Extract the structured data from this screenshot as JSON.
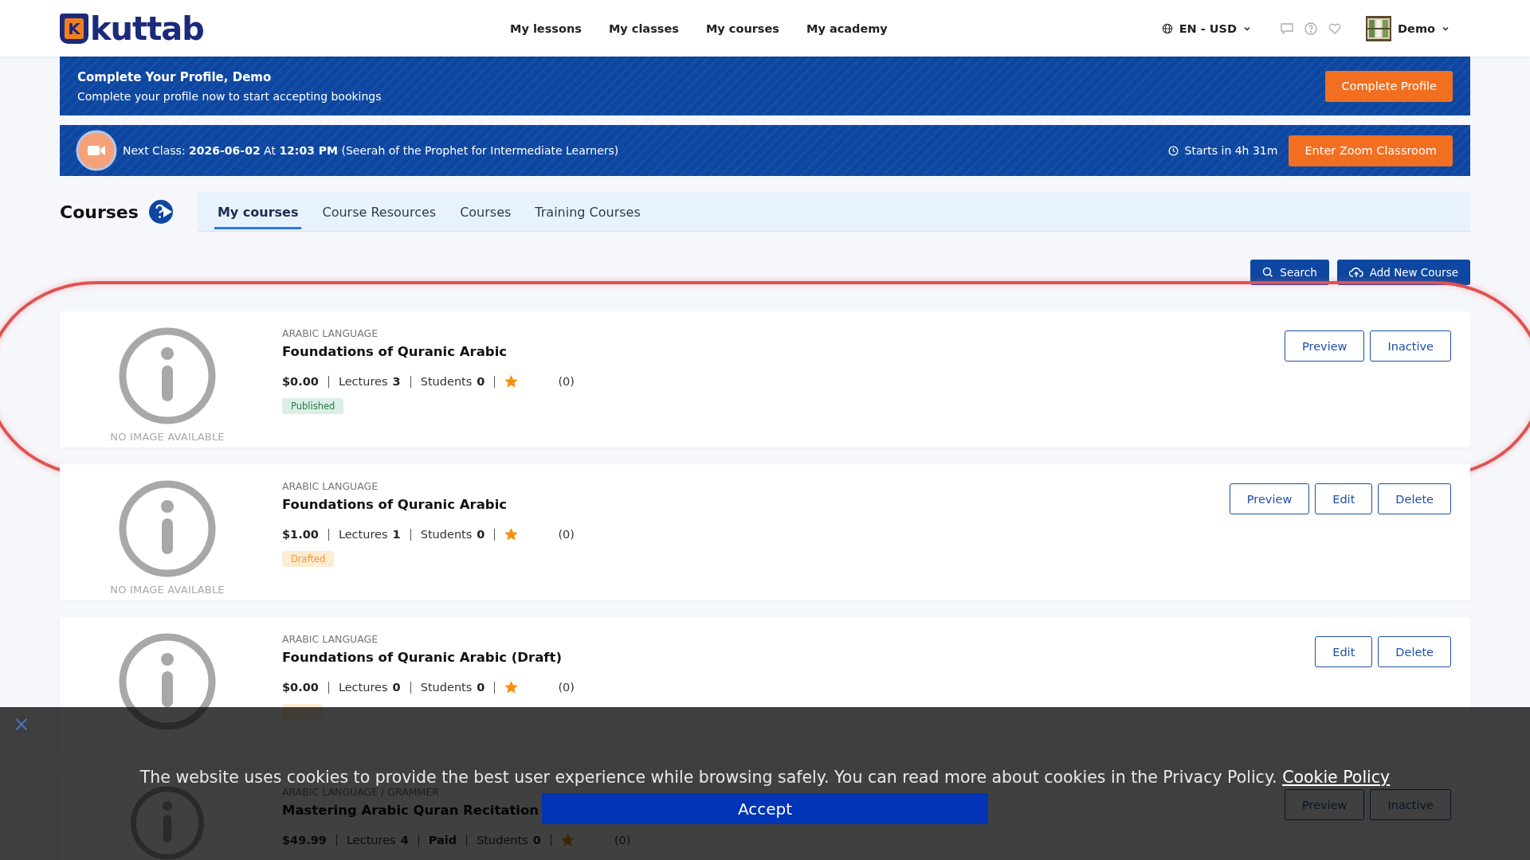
{
  "header": {
    "logo_mark": "K",
    "logo": "kuttab",
    "nav": [
      "My lessons",
      "My classes",
      "My courses",
      "My academy"
    ],
    "language": "EN - USD",
    "user": "Demo"
  },
  "profile_banner": {
    "title": "Complete Your Profile, Demo",
    "text": "Complete your profile now to start accepting bookings",
    "button": "Complete Profile"
  },
  "class_banner": {
    "text": "Next Class: **2026-06-02** At **12:03 PM** (Seerah of the Prophet for Intermediate Learners)",
    "countdown": "Starts in 4h 31m",
    "button": "Enter Zoom Classroom"
  },
  "page_title": "Courses",
  "tabs": [
    {
      "label": "My courses",
      "selected": true
    },
    {
      "label": "Course Resources",
      "selected": false
    },
    {
      "label": "Courses",
      "selected": false
    },
    {
      "label": "Training Courses",
      "selected": false
    }
  ],
  "actions": [
    {
      "label": "Search",
      "kind": "search"
    },
    {
      "label": "Add New Course",
      "kind": "upload"
    }
  ],
  "courses": [
    {
      "image_label": "NO IMAGE AVAILABLE",
      "category": "ARABIC LANGUAGE",
      "title": "Foundations of Quranic Arabic",
      "stats": [
        {
          "kind": "price",
          "value": "$0.00"
        },
        {
          "kind": "count",
          "label": "Lectures",
          "value": "3"
        },
        {
          "kind": "count",
          "label": "Students",
          "value": "0"
        },
        {
          "kind": "rating",
          "value": "(0)"
        }
      ],
      "status": {
        "label": "Published",
        "kind": "published"
      },
      "buttons": [
        "Preview",
        "Inactive"
      ],
      "highlighted": true
    },
    {
      "image_label": "NO IMAGE AVAILABLE",
      "category": "ARABIC LANGUAGE",
      "title": "Foundations of Quranic Arabic",
      "stats": [
        {
          "kind": "price",
          "value": "$1.00"
        },
        {
          "kind": "count",
          "label": "Lectures",
          "value": "1"
        },
        {
          "kind": "count",
          "label": "Students",
          "value": "0"
        },
        {
          "kind": "rating",
          "value": "(0)"
        }
      ],
      "status": {
        "label": "Drafted",
        "kind": "drafted"
      },
      "buttons": [
        "Preview",
        "Edit",
        "Delete"
      ],
      "highlighted": false
    },
    {
      "category": "ARABIC LANGUAGE",
      "title": "Foundations of Quranic Arabic (Draft)",
      "stats": [
        {
          "kind": "price",
          "value": "$0.00"
        },
        {
          "kind": "count",
          "label": "Lectures",
          "value": "0"
        },
        {
          "kind": "count",
          "label": "Students",
          "value": "0"
        },
        {
          "kind": "rating",
          "value": "(0)"
        }
      ],
      "status": {
        "kind": "drafted"
      },
      "buttons": [
        "Edit",
        "Delete"
      ],
      "highlighted": false
    },
    {
      "category": "ARABIC LANGUAGE / GRAMMER",
      "title": "Mastering Arabic Quran Recitation",
      "stats": [
        {
          "kind": "price",
          "value": "$49.99"
        },
        {
          "kind": "count",
          "label": "Lectures",
          "value": "4"
        },
        {
          "kind": "tag",
          "value": "Paid"
        },
        {
          "kind": "count",
          "label": "Students",
          "value": "0"
        },
        {
          "kind": "rating",
          "value": "(0)"
        }
      ],
      "buttons": [
        "Preview",
        "Inactive"
      ],
      "highlighted": false
    }
  ],
  "cookie_notice": {
    "close": "×",
    "text": "The website uses cookies to provide the best user experience while browsing safely. You can read more about cookies in the Privacy Policy.",
    "link": "Cookie Policy",
    "button": "Accept"
  }
}
